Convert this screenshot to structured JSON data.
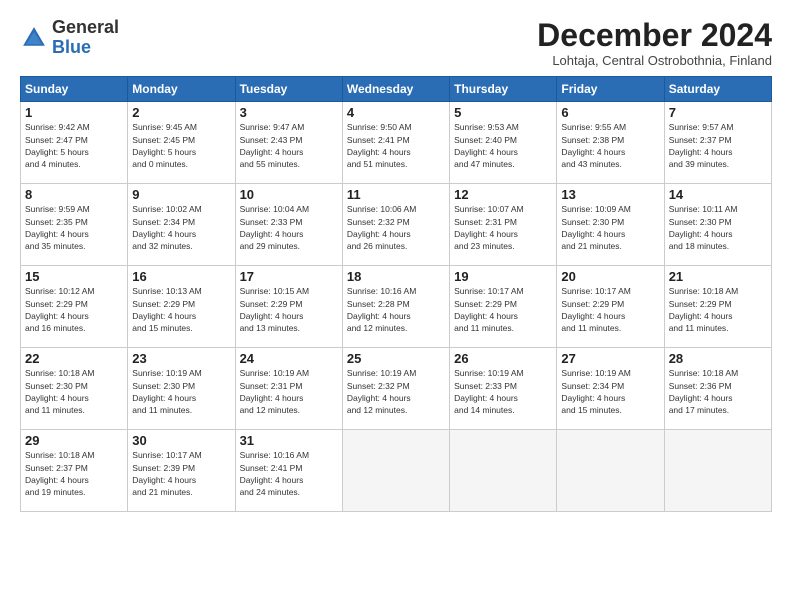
{
  "header": {
    "logo": {
      "line1": "General",
      "line2": "Blue"
    },
    "title": "December 2024",
    "location": "Lohtaja, Central Ostrobothnia, Finland"
  },
  "days": [
    "Sunday",
    "Monday",
    "Tuesday",
    "Wednesday",
    "Thursday",
    "Friday",
    "Saturday"
  ],
  "weeks": [
    [
      {
        "num": "1",
        "info": "Sunrise: 9:42 AM\nSunset: 2:47 PM\nDaylight: 5 hours\nand 4 minutes."
      },
      {
        "num": "2",
        "info": "Sunrise: 9:45 AM\nSunset: 2:45 PM\nDaylight: 5 hours\nand 0 minutes."
      },
      {
        "num": "3",
        "info": "Sunrise: 9:47 AM\nSunset: 2:43 PM\nDaylight: 4 hours\nand 55 minutes."
      },
      {
        "num": "4",
        "info": "Sunrise: 9:50 AM\nSunset: 2:41 PM\nDaylight: 4 hours\nand 51 minutes."
      },
      {
        "num": "5",
        "info": "Sunrise: 9:53 AM\nSunset: 2:40 PM\nDaylight: 4 hours\nand 47 minutes."
      },
      {
        "num": "6",
        "info": "Sunrise: 9:55 AM\nSunset: 2:38 PM\nDaylight: 4 hours\nand 43 minutes."
      },
      {
        "num": "7",
        "info": "Sunrise: 9:57 AM\nSunset: 2:37 PM\nDaylight: 4 hours\nand 39 minutes."
      }
    ],
    [
      {
        "num": "8",
        "info": "Sunrise: 9:59 AM\nSunset: 2:35 PM\nDaylight: 4 hours\nand 35 minutes."
      },
      {
        "num": "9",
        "info": "Sunrise: 10:02 AM\nSunset: 2:34 PM\nDaylight: 4 hours\nand 32 minutes."
      },
      {
        "num": "10",
        "info": "Sunrise: 10:04 AM\nSunset: 2:33 PM\nDaylight: 4 hours\nand 29 minutes."
      },
      {
        "num": "11",
        "info": "Sunrise: 10:06 AM\nSunset: 2:32 PM\nDaylight: 4 hours\nand 26 minutes."
      },
      {
        "num": "12",
        "info": "Sunrise: 10:07 AM\nSunset: 2:31 PM\nDaylight: 4 hours\nand 23 minutes."
      },
      {
        "num": "13",
        "info": "Sunrise: 10:09 AM\nSunset: 2:30 PM\nDaylight: 4 hours\nand 21 minutes."
      },
      {
        "num": "14",
        "info": "Sunrise: 10:11 AM\nSunset: 2:30 PM\nDaylight: 4 hours\nand 18 minutes."
      }
    ],
    [
      {
        "num": "15",
        "info": "Sunrise: 10:12 AM\nSunset: 2:29 PM\nDaylight: 4 hours\nand 16 minutes."
      },
      {
        "num": "16",
        "info": "Sunrise: 10:13 AM\nSunset: 2:29 PM\nDaylight: 4 hours\nand 15 minutes."
      },
      {
        "num": "17",
        "info": "Sunrise: 10:15 AM\nSunset: 2:29 PM\nDaylight: 4 hours\nand 13 minutes."
      },
      {
        "num": "18",
        "info": "Sunrise: 10:16 AM\nSunset: 2:28 PM\nDaylight: 4 hours\nand 12 minutes."
      },
      {
        "num": "19",
        "info": "Sunrise: 10:17 AM\nSunset: 2:29 PM\nDaylight: 4 hours\nand 11 minutes."
      },
      {
        "num": "20",
        "info": "Sunrise: 10:17 AM\nSunset: 2:29 PM\nDaylight: 4 hours\nand 11 minutes."
      },
      {
        "num": "21",
        "info": "Sunrise: 10:18 AM\nSunset: 2:29 PM\nDaylight: 4 hours\nand 11 minutes."
      }
    ],
    [
      {
        "num": "22",
        "info": "Sunrise: 10:18 AM\nSunset: 2:30 PM\nDaylight: 4 hours\nand 11 minutes."
      },
      {
        "num": "23",
        "info": "Sunrise: 10:19 AM\nSunset: 2:30 PM\nDaylight: 4 hours\nand 11 minutes."
      },
      {
        "num": "24",
        "info": "Sunrise: 10:19 AM\nSunset: 2:31 PM\nDaylight: 4 hours\nand 12 minutes."
      },
      {
        "num": "25",
        "info": "Sunrise: 10:19 AM\nSunset: 2:32 PM\nDaylight: 4 hours\nand 12 minutes."
      },
      {
        "num": "26",
        "info": "Sunrise: 10:19 AM\nSunset: 2:33 PM\nDaylight: 4 hours\nand 14 minutes."
      },
      {
        "num": "27",
        "info": "Sunrise: 10:19 AM\nSunset: 2:34 PM\nDaylight: 4 hours\nand 15 minutes."
      },
      {
        "num": "28",
        "info": "Sunrise: 10:18 AM\nSunset: 2:36 PM\nDaylight: 4 hours\nand 17 minutes."
      }
    ],
    [
      {
        "num": "29",
        "info": "Sunrise: 10:18 AM\nSunset: 2:37 PM\nDaylight: 4 hours\nand 19 minutes."
      },
      {
        "num": "30",
        "info": "Sunrise: 10:17 AM\nSunset: 2:39 PM\nDaylight: 4 hours\nand 21 minutes."
      },
      {
        "num": "31",
        "info": "Sunrise: 10:16 AM\nSunset: 2:41 PM\nDaylight: 4 hours\nand 24 minutes."
      },
      null,
      null,
      null,
      null
    ]
  ]
}
